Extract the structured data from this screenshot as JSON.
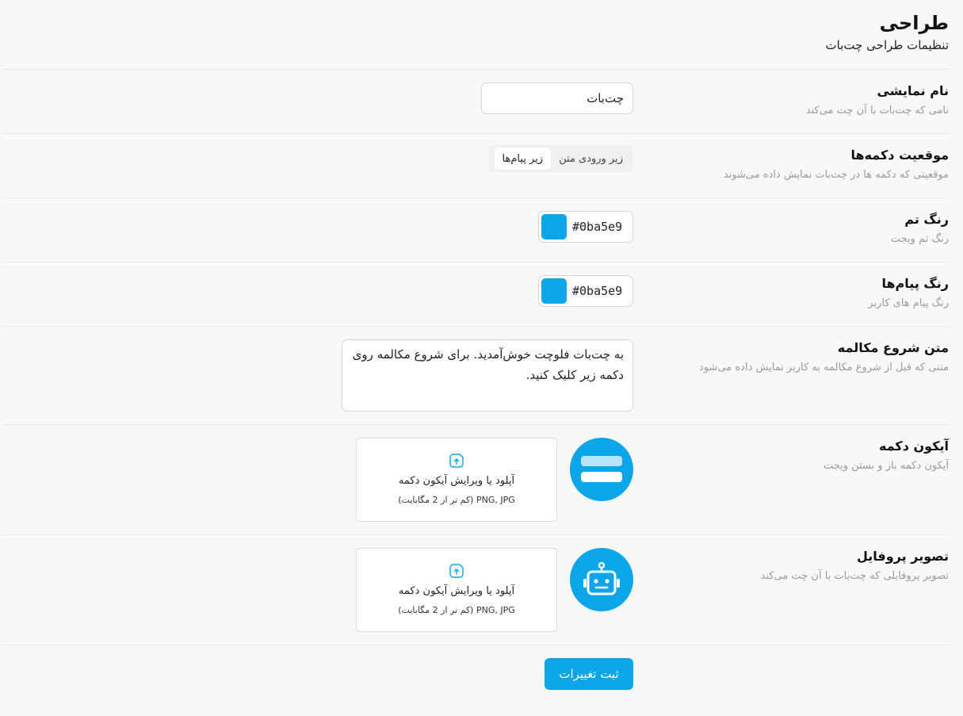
{
  "header": {
    "title": "طراحی",
    "subtitle": "تنظیمات طراحی چت‌بات"
  },
  "display_name": {
    "label": "نام نمایشی",
    "description": "نامی که چت‌بات با آن چت می‌کند",
    "value": "چت‌بات"
  },
  "buttons_position": {
    "label": "موقعیت دکمه‌ها",
    "description": "موقعیتی که دکمه ها در چت‌بات نمایش داده می‌شوند",
    "options": [
      "زیر ورودی متن",
      "زیر پیام‌ها"
    ],
    "selected": "زیر پیام‌ها"
  },
  "theme_color": {
    "label": "رنگ تم",
    "description": "رنگ تم ویجت",
    "value": "#0ba5e9"
  },
  "message_color": {
    "label": "رنگ پیام‌ها",
    "description": "رنگ پیام های کاربر",
    "value": "#0ba5e9"
  },
  "start_text": {
    "label": "متن شروع مکالمه",
    "description": "متنی که قبل از شروع مکالمه به کاربر نمایش داده می‌شود",
    "value": "به چت‌بات فلوچت خوش‌آمدید. برای شروع مکالمه روی دکمه زیر کلیک کنید."
  },
  "button_icon": {
    "label": "آیکون دکمه",
    "description": "آیکون دکمه باز و بستن ویجت",
    "upload_title": "آپلود یا ویرایش آیکون دکمه",
    "upload_hint": "PNG, JPG (کم تر از 2 مگابایت)",
    "preview_icon": "chat-bubble-icon",
    "upload_icon": "file-upload-icon"
  },
  "profile_image": {
    "label": "تصویر پروفایل",
    "description": "تصویر پروفایلی که چت‌بات با آن چت می‌کند",
    "upload_title": "آپلود یا ویرایش آیکون دکمه",
    "upload_hint": "PNG, JPG (کم تر از 2 مگابایت)",
    "preview_icon": "robot-icon",
    "upload_icon": "file-upload-icon"
  },
  "submit": {
    "label": "ثبت تغییرات"
  },
  "colors": {
    "accent": "#0ba5e9",
    "background": "#f8f8f8"
  }
}
